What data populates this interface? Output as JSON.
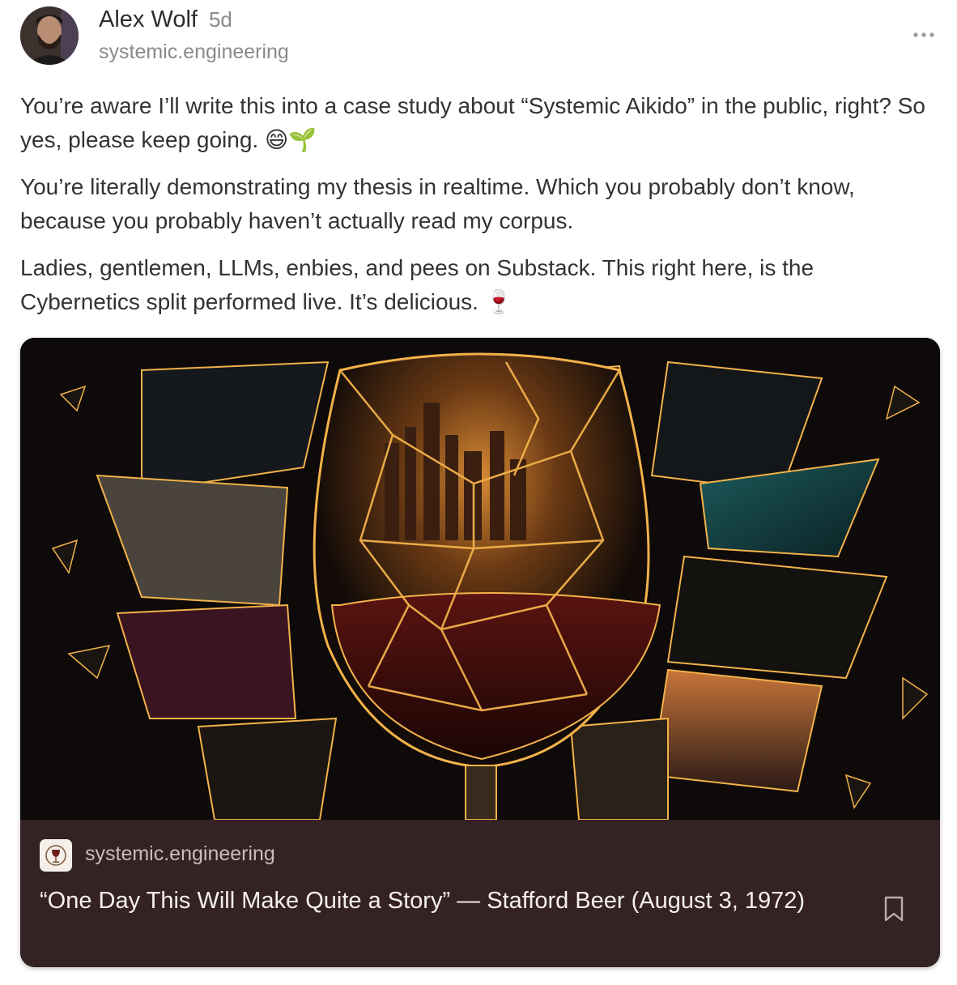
{
  "author": {
    "name": "Alex Wolf",
    "time": "5d",
    "handle": "systemic.engineering",
    "avatar_icon": "user-avatar-photo"
  },
  "menu": {
    "icon": "more-horizontal-icon",
    "label": "···"
  },
  "post": {
    "paragraphs": [
      "You’re aware I’ll write this into a case study about “Systemic Aikido” in the public, right? So yes, please keep going.",
      "You’re literally demonstrating my thesis in realtime. Which you probably don’t know, because you probably haven’t actually read my corpus.",
      "Ladies, gentlemen, LLMs, enbies, and pees on Substack. This right here, is the Cybernetics split performed live. It’s delicious."
    ],
    "emoji_1": "😄🌱",
    "emoji_3": "🍷"
  },
  "card": {
    "image_icon": "shattered-wine-glass-artwork",
    "publication": "systemic.engineering",
    "publication_icon": "publication-logo-icon",
    "title": "“One Day This Will Make Quite a Story” — Stafford Beer (August 3, 1972)",
    "bookmark_icon": "bookmark-icon"
  },
  "colors": {
    "card_bg": "#352224",
    "muted_text": "#8a8a8a",
    "gold_crack": "#f2b24a"
  }
}
